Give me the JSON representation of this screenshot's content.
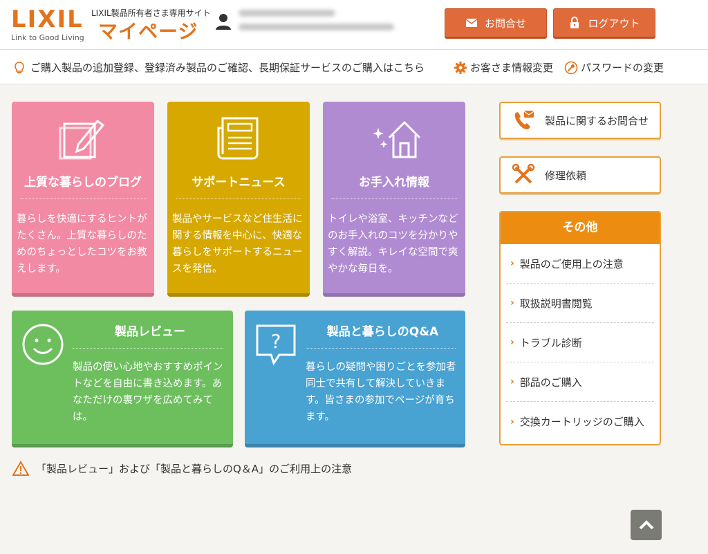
{
  "header": {
    "logo_text": "LIXIL",
    "logo_tagline": "Link to Good Living",
    "site_subtitle": "LIXIL製品所有者さま専用サイト",
    "site_title": "マイページ",
    "contact_label": "お問合せ",
    "logout_label": "ログアウト"
  },
  "subbar": {
    "notice": "ご購入製品の追加登録、登録済み製品のご確認、長期保証サービスのご購入はこちら",
    "customer_info": "お客さま情報変更",
    "password": "パスワードの変更"
  },
  "tiles": [
    {
      "title": "上質な暮らしのブログ",
      "text": "暮らしを快適にするヒントがたくさん。上質な暮らしのためのちょっとしたコツをお教えします。",
      "color": "#f28aa3",
      "icon": "pencil-note-icon"
    },
    {
      "title": "サポートニュース",
      "text": "製品やサービスなど住生活に関する情報を中心に、快適な暮らしをサポートするニュースを発信。",
      "color": "#d6a800",
      "icon": "newspaper-icon"
    },
    {
      "title": "お手入れ情報",
      "text": "トイレや浴室、キッチンなどのお手入れのコツを分かりやすく解説。キレイな空間で爽やかな毎日を。",
      "color": "#b08bd2",
      "icon": "sparkle-house-icon"
    },
    {
      "title": "製品レビュー",
      "text": "製品の使い心地やおすすめポイントなどを自由に書き込めます。あなただけの裏ワザを広めてみては。",
      "color": "#6dbf5e",
      "icon": "smiley-icon"
    },
    {
      "title": "製品と暮らしのQ&A",
      "text": "暮らしの疑問や困りごとを参加者同士で共有して解決していきます。皆さまの参加でページが育ちます。",
      "color": "#48a2d2",
      "icon": "question-bubble-icon"
    }
  ],
  "side": {
    "inquiry_label": "製品に関するお問合せ",
    "repair_label": "修理依頼",
    "other_title": "その他",
    "other_items": [
      "製品のご使用上の注意",
      "取扱説明書閲覧",
      "トラブル診断",
      "部品のご購入",
      "交換カートリッジのご購入"
    ]
  },
  "bottom": {
    "notice_link": "「製品レビュー」および「製品と暮らしのQ＆A」のご利用上の注意"
  },
  "colors": {
    "accent": "#e3731c",
    "button": "#e06a3a",
    "border": "#e8a13a"
  }
}
